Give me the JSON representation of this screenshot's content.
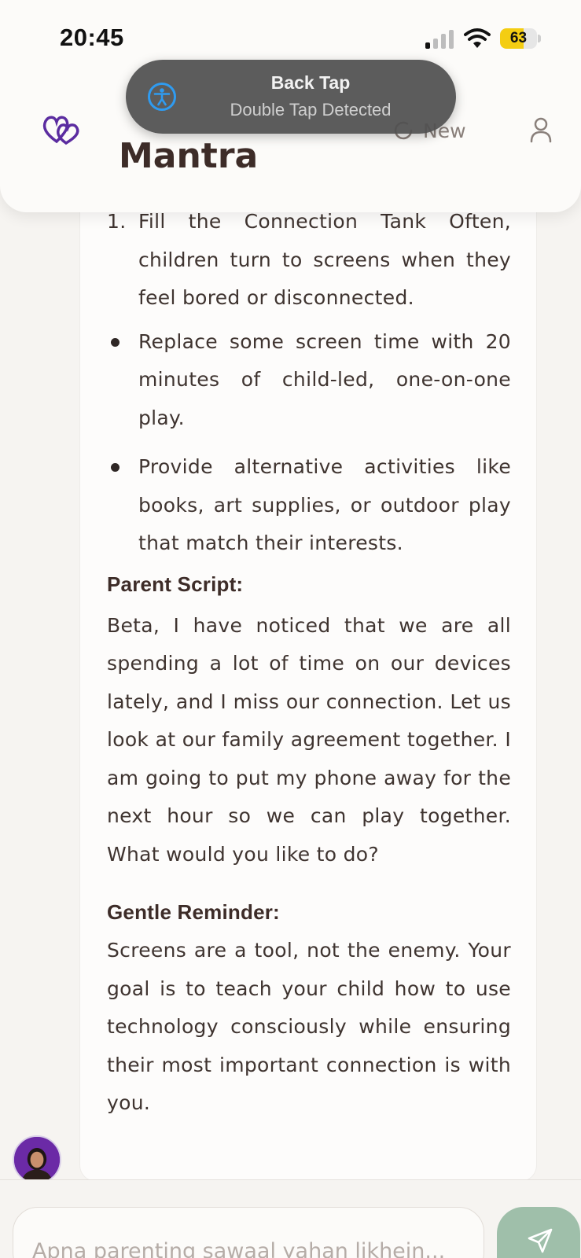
{
  "status_bar": {
    "time": "20:45",
    "battery": "63",
    "battery_level": 0.63
  },
  "header": {
    "app_title": "Mantra",
    "new_label": "New",
    "icons": [
      "heart-logo-icon",
      "refresh-icon",
      "profile-icon"
    ]
  },
  "banner": {
    "title": "Back Tap",
    "subtitle": "Double Tap Detected",
    "icon": "accessibility-icon"
  },
  "message": {
    "list_item": {
      "number": "1.",
      "text": "Fill the Connection Tank Often, children turn to screens when they feel bored or disconnected."
    },
    "bullets": [
      "Replace some screen time with 20 minutes of child-led, one-on-one play.",
      "Provide alternative activities like books, art supplies, or outdoor play that match their interests."
    ],
    "parent_script_title": "Parent Script:",
    "parent_script_text": "Beta, I have noticed that we are all spending a lot of time on our devices lately, and I miss our connection. Let us look at our family agreement together. I am going to put my phone away for the next hour so we can play together. What would you like to do?",
    "reminder_title": "Gentle Reminder:",
    "reminder_text": "Screens are a tool, not the enemy. Your goal is to teach your child how to use technology consciously while ensuring their most important connection is with you."
  },
  "composer": {
    "placeholder": "Apna parenting sawaal yahan likhein...",
    "send_icon": "send-icon"
  },
  "colors": {
    "accent": "#9fbfaa",
    "logo": "#5b2ca0",
    "banner_bg": "#505050",
    "battery": "#f4cd12"
  }
}
